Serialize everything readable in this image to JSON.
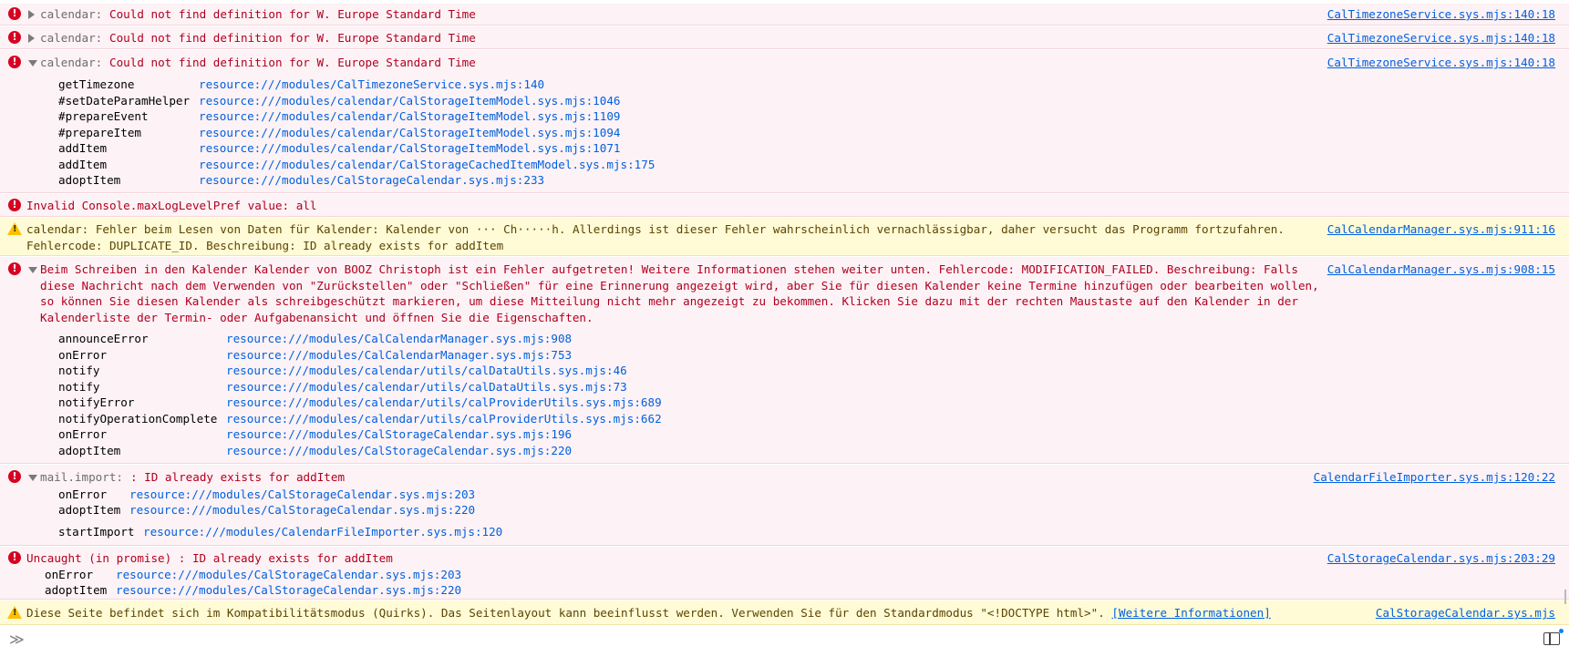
{
  "messages": [
    {
      "prefix": "calendar:",
      "text": "Could not find definition for W. Europe Standard Time",
      "location": "CalTimezoneService.sys.mjs:140:18"
    },
    {
      "prefix": "calendar:",
      "text": "Could not find definition for W. Europe Standard Time",
      "location": "CalTimezoneService.sys.mjs:140:18"
    },
    {
      "prefix": "calendar:",
      "text": "Could not find definition for W. Europe Standard Time",
      "location": "CalTimezoneService.sys.mjs:140:18",
      "stack": [
        {
          "fn": "getTimezone",
          "loc": "resource:///modules/CalTimezoneService.sys.mjs:140"
        },
        {
          "fn": "#setDateParamHelper",
          "loc": "resource:///modules/calendar/CalStorageItemModel.sys.mjs:1046"
        },
        {
          "fn": "#prepareEvent",
          "loc": "resource:///modules/calendar/CalStorageItemModel.sys.mjs:1109"
        },
        {
          "fn": "#prepareItem",
          "loc": "resource:///modules/calendar/CalStorageItemModel.sys.mjs:1094"
        },
        {
          "fn": "addItem",
          "loc": "resource:///modules/calendar/CalStorageItemModel.sys.mjs:1071"
        },
        {
          "fn": "addItem",
          "loc": "resource:///modules/calendar/CalStorageCachedItemModel.sys.mjs:175"
        },
        {
          "fn": "adoptItem",
          "loc": "resource:///modules/CalStorageCalendar.sys.mjs:233"
        }
      ]
    },
    {
      "text": "Invalid Console.maxLogLevelPref value: all"
    },
    {
      "text": "calendar: Fehler beim Lesen von Daten für Kalender: Kalender von ··· Ch·····h. Allerdings ist dieser Fehler wahrscheinlich vernachlässigbar, daher versucht das Programm fortzufahren. Fehlercode: DUPLICATE_ID. Beschreibung: ID already exists for addItem",
      "location": "CalCalendarManager.sys.mjs:911:16"
    },
    {
      "text": "Beim Schreiben in den Kalender Kalender von BOOZ Christoph ist ein Fehler aufgetreten! Weitere Informationen stehen weiter unten. Fehlercode: MODIFICATION_FAILED. Beschreibung: Falls diese Nachricht nach dem Verwenden von \"Zurückstellen\" oder \"Schließen\" für eine Erinnerung angezeigt wird, aber Sie für diesen Kalender keine Termine hinzufügen oder bearbeiten wollen, so können Sie diesen Kalender als schreibgeschützt markieren, um diese Mitteilung nicht mehr angezeigt zu bekommen. Klicken Sie dazu mit der rechten Maustaste auf den Kalender in der Kalenderliste der Termin- oder Aufgabenansicht und öffnen Sie die Eigenschaften.",
      "location": "CalCalendarManager.sys.mjs:908:15",
      "stack": [
        {
          "fn": "announceError",
          "loc": "resource:///modules/CalCalendarManager.sys.mjs:908"
        },
        {
          "fn": "onError",
          "loc": "resource:///modules/CalCalendarManager.sys.mjs:753"
        },
        {
          "fn": "notify",
          "loc": "resource:///modules/calendar/utils/calDataUtils.sys.mjs:46"
        },
        {
          "fn": "notify",
          "loc": "resource:///modules/calendar/utils/calDataUtils.sys.mjs:73"
        },
        {
          "fn": "notifyError",
          "loc": "resource:///modules/calendar/utils/calProviderUtils.sys.mjs:689"
        },
        {
          "fn": "notifyOperationComplete",
          "loc": "resource:///modules/calendar/utils/calProviderUtils.sys.mjs:662"
        },
        {
          "fn": "onError",
          "loc": "resource:///modules/CalStorageCalendar.sys.mjs:196"
        },
        {
          "fn": "adoptItem",
          "loc": "resource:///modules/CalStorageCalendar.sys.mjs:220"
        }
      ]
    },
    {
      "prefix": "mail.import:",
      "text": ": ID already exists for addItem",
      "location": "CalendarFileImporter.sys.mjs:120:22",
      "stack": [
        {
          "fn": "onError",
          "loc": "resource:///modules/CalStorageCalendar.sys.mjs:203"
        },
        {
          "fn": "adoptItem",
          "loc": "resource:///modules/CalStorageCalendar.sys.mjs:220"
        },
        {
          "fn": "startImport",
          "loc": "resource:///modules/CalendarFileImporter.sys.mjs:120"
        }
      ]
    },
    {
      "text": "Uncaught (in promise) : ID already exists for addItem",
      "location": "CalStorageCalendar.sys.mjs:203:29",
      "stack": [
        {
          "fn": "onError",
          "loc": "resource:///modules/CalStorageCalendar.sys.mjs:203"
        },
        {
          "fn": "adoptItem",
          "loc": "resource:///modules/CalStorageCalendar.sys.mjs:220"
        }
      ]
    },
    {
      "text": "Diese Seite befindet sich im Kompatibilitätsmodus (Quirks). Das Seitenlayout kann beeinflusst werden. Verwenden Sie für den Standardmodus \"<!DOCTYPE html>\".",
      "link": "[Weitere Informationen]",
      "location": "CalStorageCalendar.sys.mjs"
    }
  ],
  "input": {
    "prompt": "≫"
  },
  "colors": {
    "error_bg": "#fdf2f5",
    "warning_bg": "#fffbd6",
    "error_text": "#b00020",
    "link": "#0060df"
  }
}
